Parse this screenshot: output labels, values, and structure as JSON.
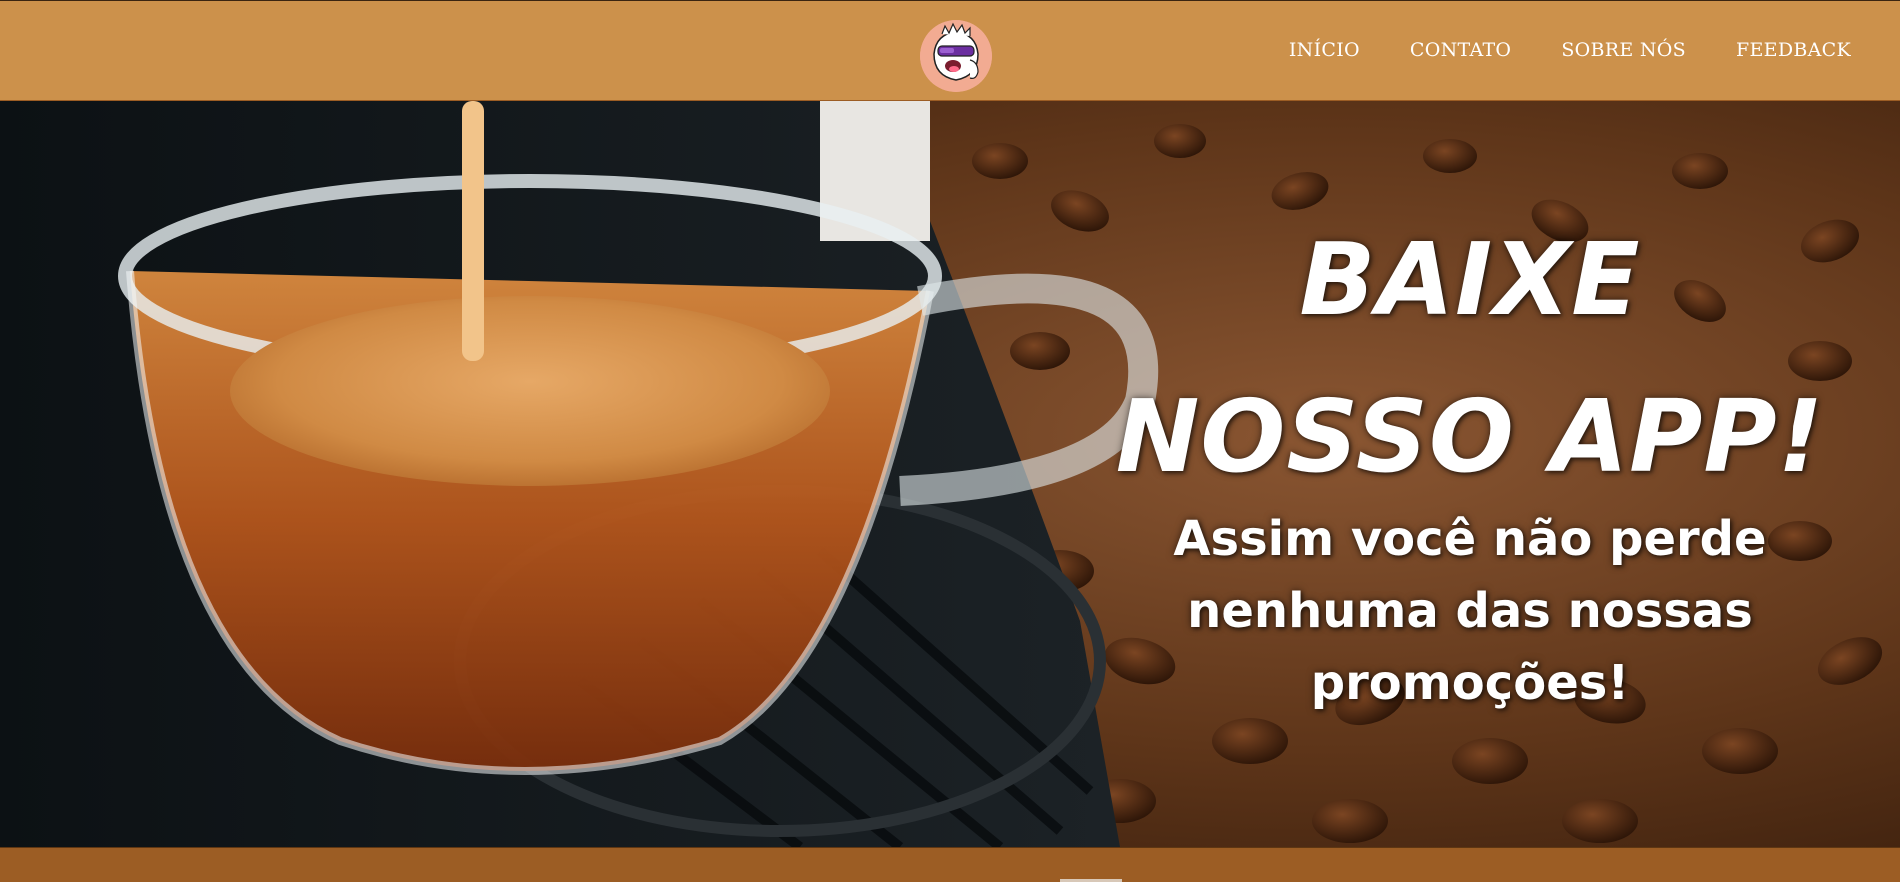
{
  "header": {
    "brand_logo": "cartoon-mascot-logo",
    "nav": [
      {
        "label": "INÍCIO"
      },
      {
        "label": "CONTATO"
      },
      {
        "label": "SOBRE NÓS"
      },
      {
        "label": "FEEDBACK"
      }
    ]
  },
  "banner": {
    "headline_line1": "BAIXE",
    "headline_line2": "NOSSO APP!",
    "subtitle": "Assim você não perde nenhuma das nossas promoções!",
    "image": "espresso-cup-and-coffee-beans"
  },
  "colors": {
    "header_bg": "#cc914b",
    "footer_bg": "#9c5d24",
    "text": "#ffffff"
  }
}
